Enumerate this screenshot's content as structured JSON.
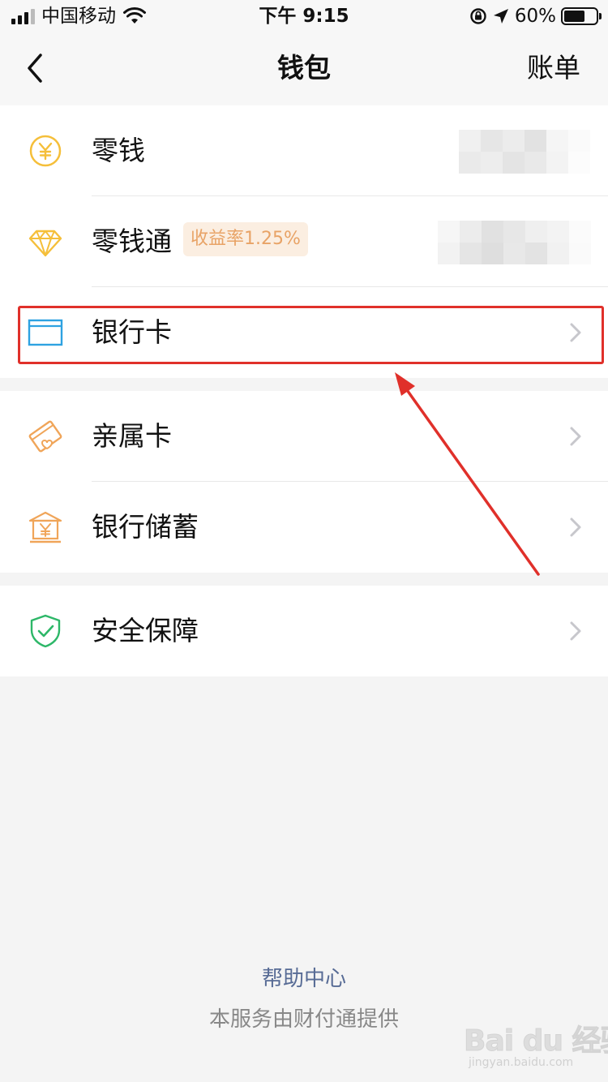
{
  "status_bar": {
    "carrier": "中国移动",
    "time": "下午 9:15",
    "battery_percent": "60%",
    "battery_level": 0.6
  },
  "nav": {
    "title": "钱包",
    "right_action": "账单"
  },
  "wallet_items": [
    {
      "label": "零钱",
      "icon": "yuan-coin-icon"
    },
    {
      "label": "零钱通",
      "icon": "diamond-icon",
      "badge": "收益率1.25%"
    },
    {
      "label": "银行卡",
      "icon": "bank-card-icon"
    }
  ],
  "service_items": [
    {
      "label": "亲属卡",
      "icon": "family-card-icon"
    },
    {
      "label": "银行储蓄",
      "icon": "bank-savings-icon"
    }
  ],
  "security_items": [
    {
      "label": "安全保障",
      "icon": "shield-check-icon"
    }
  ],
  "footer": {
    "help_link": "帮助中心",
    "provider_note": "本服务由财付通提供"
  },
  "watermark": {
    "main": "Bai du 经验",
    "sub": "jingyan.baidu.com"
  },
  "colors": {
    "accent_yellow": "#f5bf3a",
    "bank_card_blue": "#2ea2e1",
    "orange": "#f0a559",
    "green": "#2db768",
    "link_blue": "#576b95",
    "annotation_red": "#e0302a"
  }
}
